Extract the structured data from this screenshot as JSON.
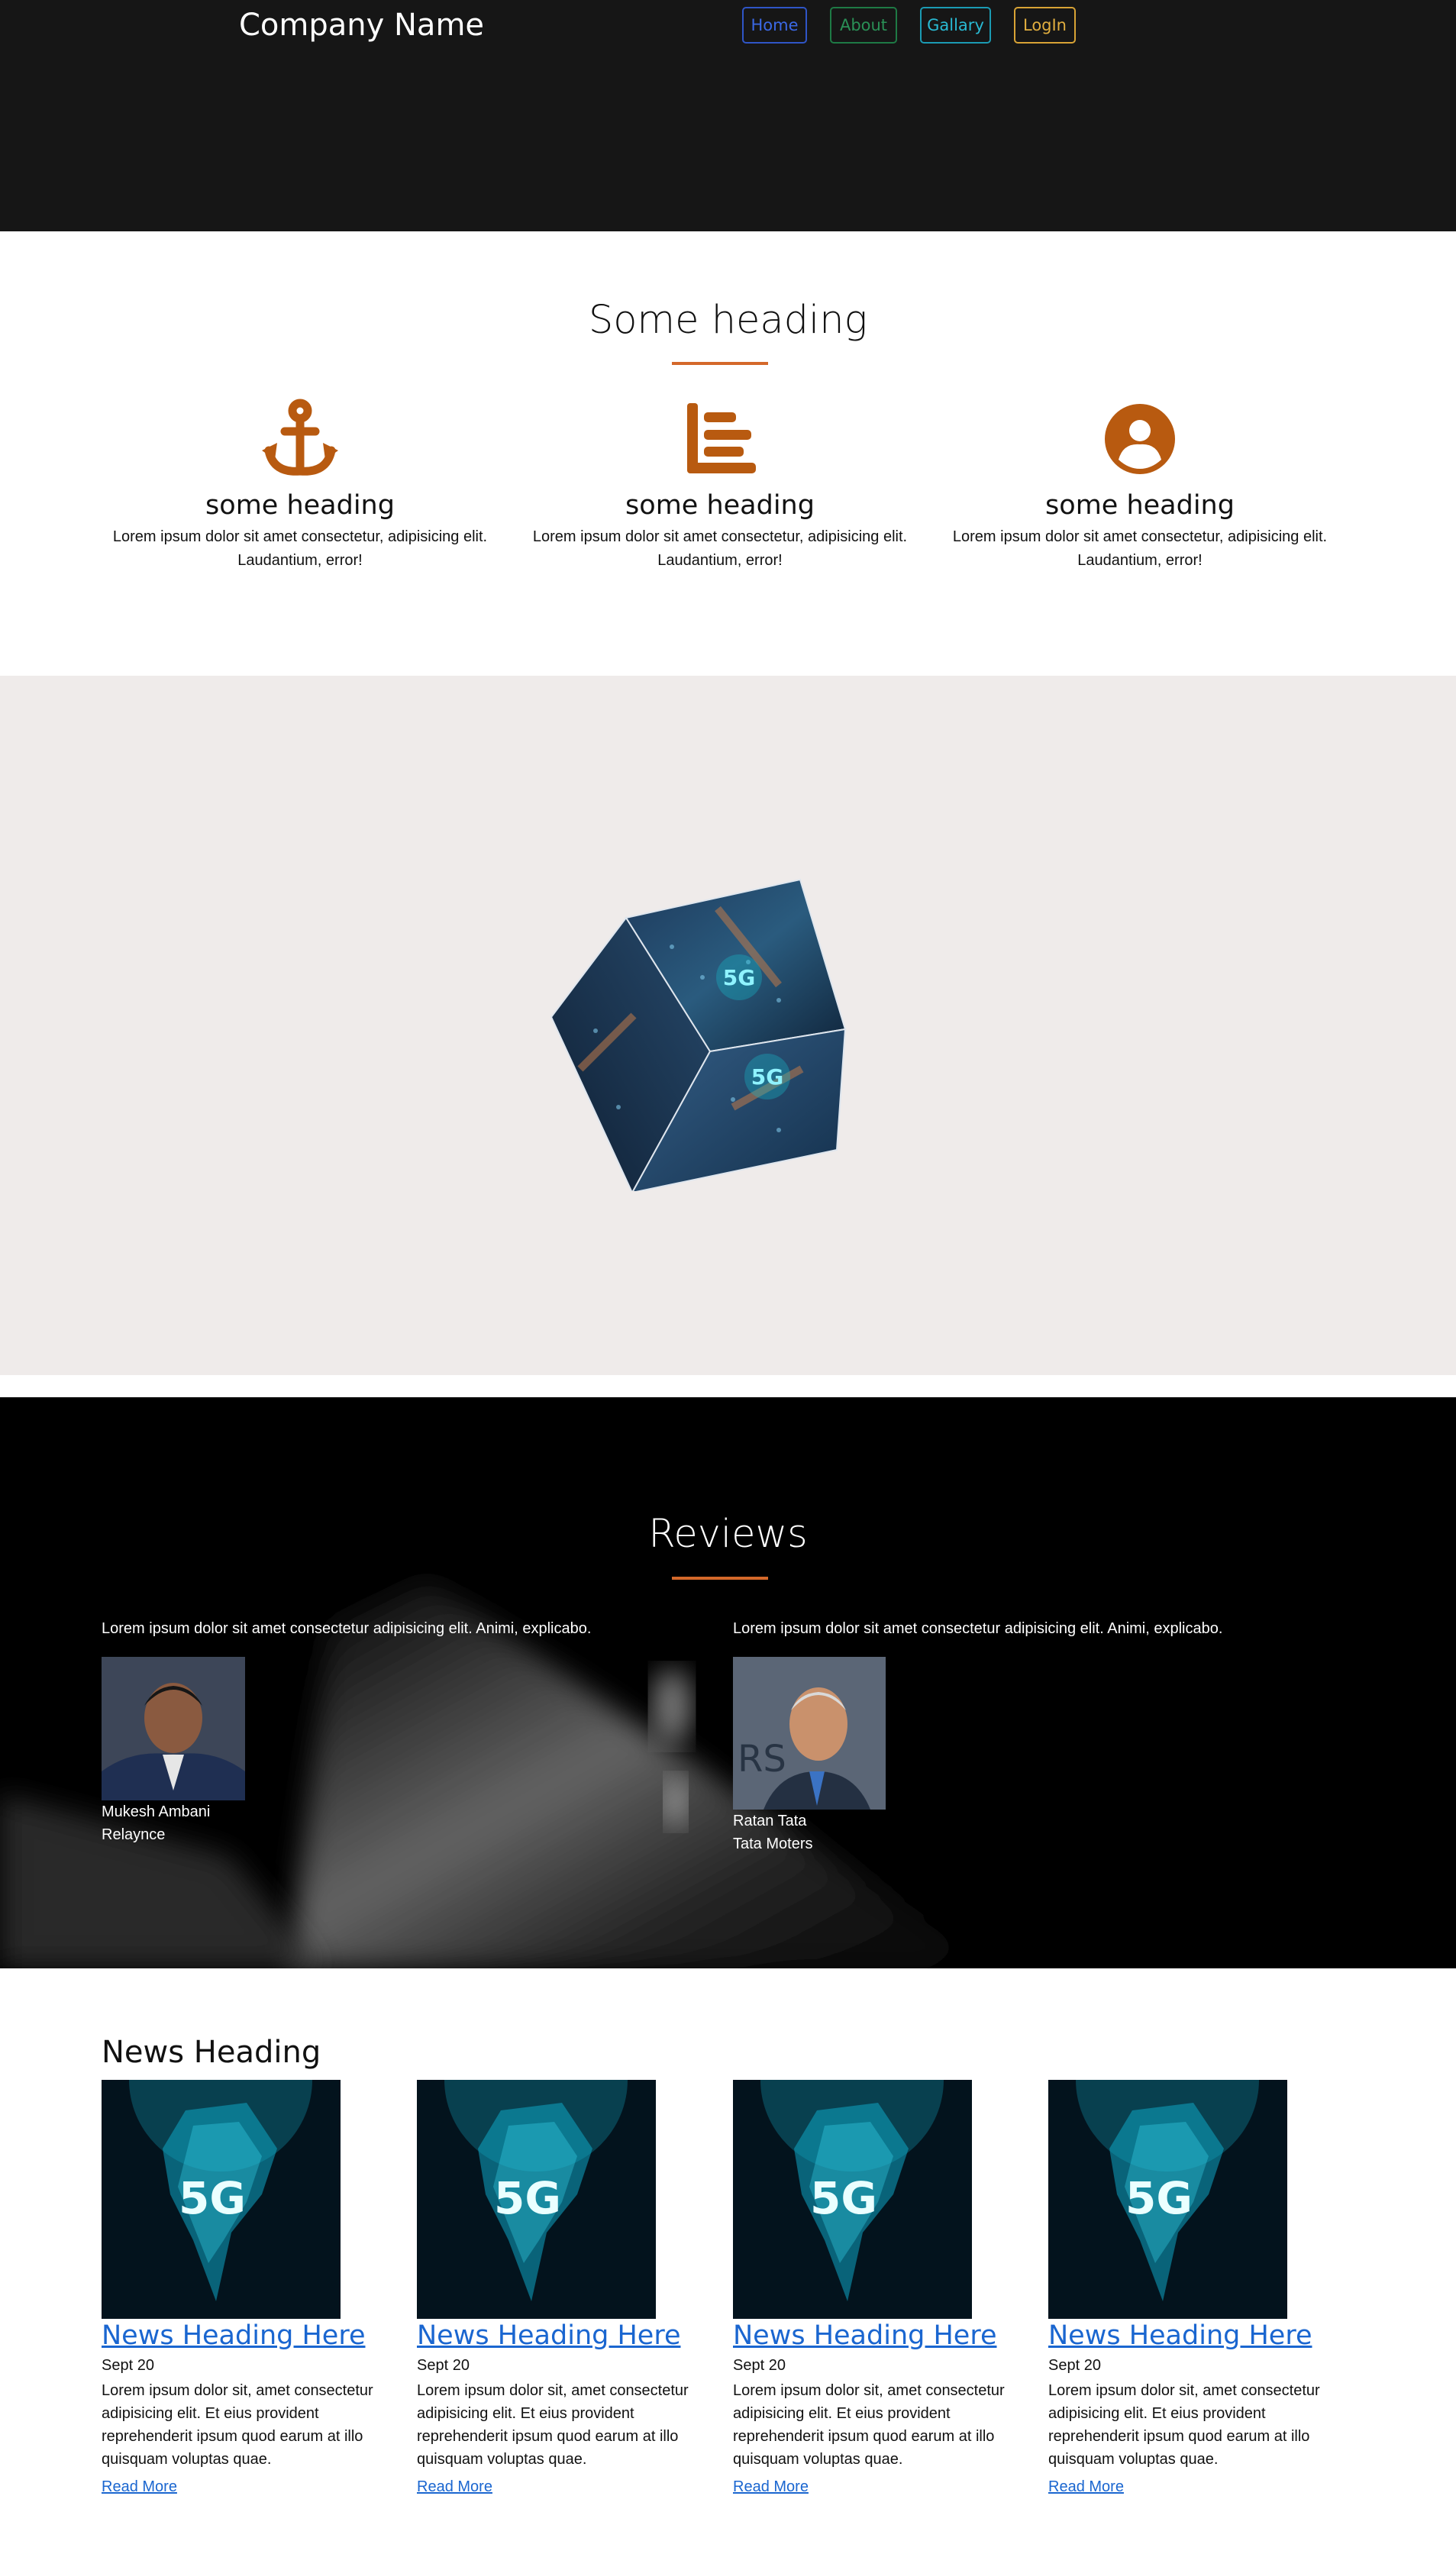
{
  "header": {
    "brand": "Company Name",
    "nav": [
      "Home",
      "About",
      "Gallary",
      "LogIn"
    ]
  },
  "features": {
    "heading": "Some heading",
    "items": [
      {
        "icon": "anchor-icon",
        "title": "some heading",
        "text": "Lorem ipsum dolor sit amet consectetur, adipisicing elit. Laudantium, error!"
      },
      {
        "icon": "bar-chart-icon",
        "title": "some heading",
        "text": "Lorem ipsum dolor sit amet consectetur, adipisicing elit. Laudantium, error!"
      },
      {
        "icon": "user-circle-icon",
        "title": "some heading",
        "text": "Lorem ipsum dolor sit amet consectetur, adipisicing elit. Laudantium, error!"
      }
    ]
  },
  "cube": {
    "face_labels": [
      "5G",
      "5G"
    ]
  },
  "reviews": {
    "heading": "Reviews",
    "items": [
      {
        "text": "Lorem ipsum dolor sit amet consectetur adipisicing elit. Animi, explicabo.",
        "name": "Mukesh Ambani",
        "company": "Relaynce"
      },
      {
        "text": "Lorem ipsum dolor sit amet consectetur adipisicing elit. Animi, explicabo.",
        "name": "Ratan Tata",
        "company": "Tata Moters"
      }
    ]
  },
  "news": {
    "heading": "News Heading",
    "items": [
      {
        "img_label": "5G",
        "title": "News Heading Here",
        "date": "Sept 20",
        "body": "Lorem ipsum dolor sit, amet consectetur adipisicing elit. Et eius provident reprehenderit ipsum quod earum at illo quisquam voluptas quae.",
        "more": "Read More"
      },
      {
        "img_label": "5G",
        "title": "News Heading Here",
        "date": "Sept 20",
        "body": "Lorem ipsum dolor sit, amet consectetur adipisicing elit. Et eius provident reprehenderit ipsum quod earum at illo quisquam voluptas quae.",
        "more": "Read More"
      },
      {
        "img_label": "5G",
        "title": "News Heading Here",
        "date": "Sept 20",
        "body": "Lorem ipsum dolor sit, amet consectetur adipisicing elit. Et eius provident reprehenderit ipsum quod earum at illo quisquam voluptas quae.",
        "more": "Read More"
      },
      {
        "img_label": "5G",
        "title": "News Heading Here",
        "date": "Sept 20",
        "body": "Lorem ipsum dolor sit, amet consectetur adipisicing elit. Et eius provident reprehenderit ipsum quod earum at illo quisquam voluptas quae.",
        "more": "Read More"
      }
    ]
  },
  "colors": {
    "accent": "#d4682a",
    "icon": "#b85a10",
    "link": "#1a66d0",
    "header_bg": "#161616",
    "cube_bg": "#efebea"
  }
}
